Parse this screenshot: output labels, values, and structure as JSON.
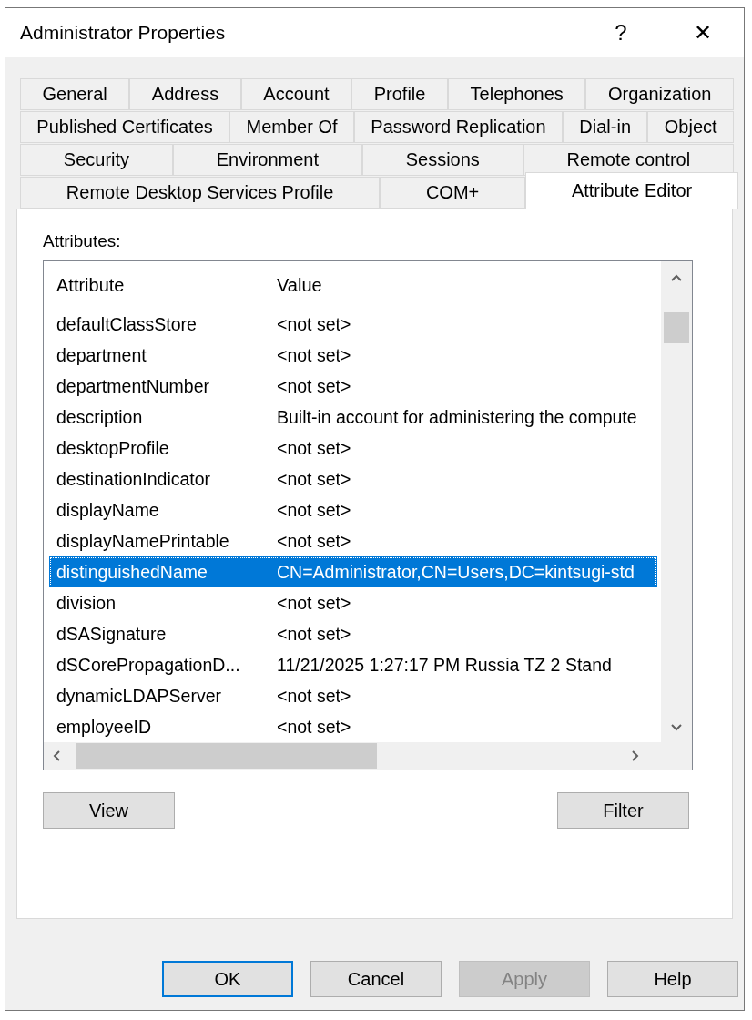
{
  "window": {
    "title": "Administrator Properties",
    "help_glyph": "?",
    "close_glyph": "✕"
  },
  "tab_rows": [
    [
      {
        "label": "General",
        "selected": false
      },
      {
        "label": "Address",
        "selected": false
      },
      {
        "label": "Account",
        "selected": false
      },
      {
        "label": "Profile",
        "selected": false
      },
      {
        "label": "Telephones",
        "selected": false
      },
      {
        "label": "Organization",
        "selected": false
      }
    ],
    [
      {
        "label": "Published Certificates",
        "selected": false
      },
      {
        "label": "Member Of",
        "selected": false
      },
      {
        "label": "Password Replication",
        "selected": false
      },
      {
        "label": "Dial-in",
        "selected": false
      },
      {
        "label": "Object",
        "selected": false
      }
    ],
    [
      {
        "label": "Security",
        "selected": false
      },
      {
        "label": "Environment",
        "selected": false
      },
      {
        "label": "Sessions",
        "selected": false
      },
      {
        "label": "Remote control",
        "selected": false
      }
    ],
    [
      {
        "label": "Remote Desktop Services Profile",
        "selected": false
      },
      {
        "label": "COM+",
        "selected": false
      },
      {
        "label": "Attribute Editor",
        "selected": true
      }
    ]
  ],
  "attributes": {
    "label": "Attributes:",
    "columns": [
      "Attribute",
      "Value"
    ],
    "rows": [
      {
        "attribute": "defaultClassStore",
        "value": "<not set>",
        "selected": false
      },
      {
        "attribute": "department",
        "value": "<not set>",
        "selected": false
      },
      {
        "attribute": "departmentNumber",
        "value": "<not set>",
        "selected": false
      },
      {
        "attribute": "description",
        "value": "Built-in account for administering the compute",
        "selected": false
      },
      {
        "attribute": "desktopProfile",
        "value": "<not set>",
        "selected": false
      },
      {
        "attribute": "destinationIndicator",
        "value": "<not set>",
        "selected": false
      },
      {
        "attribute": "displayName",
        "value": "<not set>",
        "selected": false
      },
      {
        "attribute": "displayNamePrintable",
        "value": "<not set>",
        "selected": false
      },
      {
        "attribute": "distinguishedName",
        "value": "CN=Administrator,CN=Users,DC=kintsugi-std",
        "selected": true
      },
      {
        "attribute": "division",
        "value": "<not set>",
        "selected": false
      },
      {
        "attribute": "dSASignature",
        "value": "<not set>",
        "selected": false
      },
      {
        "attribute": "dSCorePropagationD...",
        "value": "11/21/2025 1:27:17 PM Russia TZ 2 Stand",
        "selected": false
      },
      {
        "attribute": "dynamicLDAPServer",
        "value": "<not set>",
        "selected": false
      },
      {
        "attribute": "employeeID",
        "value": "<not set>",
        "selected": false
      }
    ]
  },
  "panel_buttons": [
    {
      "label": "View"
    },
    {
      "label": "Filter"
    }
  ],
  "dialog_buttons": [
    {
      "label": "OK",
      "default": true,
      "disabled": false
    },
    {
      "label": "Cancel",
      "default": false,
      "disabled": false
    },
    {
      "label": "Apply",
      "default": false,
      "disabled": true
    },
    {
      "label": "Help",
      "default": false,
      "disabled": false
    }
  ]
}
